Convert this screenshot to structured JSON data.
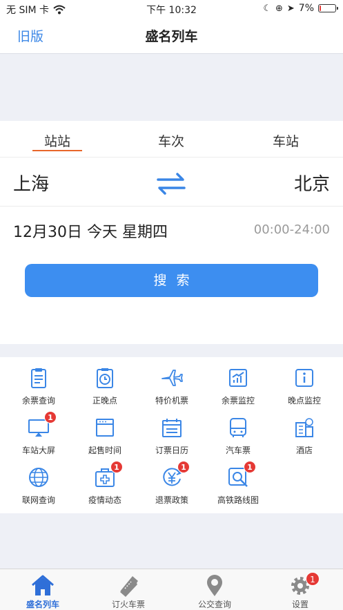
{
  "status_bar": {
    "carrier": "无 SIM 卡",
    "time": "下午 10:32",
    "battery": "7%",
    "battery_level": 0.07
  },
  "nav": {
    "back_label": "旧版",
    "title": "盛名列车"
  },
  "search": {
    "tabs": [
      {
        "label": "站站",
        "active": true
      },
      {
        "label": "车次",
        "active": false
      },
      {
        "label": "车站",
        "active": false
      }
    ],
    "from_station": "上海",
    "to_station": "北京",
    "date_text": "12月30日 今天 星期四",
    "time_range": "00:00-24:00",
    "search_button": "搜索"
  },
  "grid": [
    {
      "label": "余票查询",
      "icon": "clipboard-icon",
      "badge": null
    },
    {
      "label": "正晚点",
      "icon": "clock-icon",
      "badge": null
    },
    {
      "label": "特价机票",
      "icon": "airplane-icon",
      "badge": null
    },
    {
      "label": "余票监控",
      "icon": "chart-icon",
      "badge": null
    },
    {
      "label": "晚点监控",
      "icon": "info-icon",
      "badge": null
    },
    {
      "label": "车站大屏",
      "icon": "screen-icon",
      "badge": "1"
    },
    {
      "label": "起售时间",
      "icon": "window-icon",
      "badge": null
    },
    {
      "label": "订票日历",
      "icon": "calendar-icon",
      "badge": null
    },
    {
      "label": "汽车票",
      "icon": "bus-icon",
      "badge": null
    },
    {
      "label": "酒店",
      "icon": "hotel-icon",
      "badge": null
    },
    {
      "label": "联网查询",
      "icon": "globe-icon",
      "badge": null
    },
    {
      "label": "疫情动态",
      "icon": "medical-kit-icon",
      "badge": "1"
    },
    {
      "label": "退票政策",
      "icon": "yen-refund-icon",
      "badge": "1"
    },
    {
      "label": "高铁路线图",
      "icon": "map-search-icon",
      "badge": "1"
    }
  ],
  "tab_bar": [
    {
      "label": "盛名列车",
      "icon": "home-icon",
      "active": true,
      "badge": null
    },
    {
      "label": "订火车票",
      "icon": "ticket-icon",
      "active": false,
      "badge": null
    },
    {
      "label": "公交查询",
      "icon": "location-pin-icon",
      "active": false,
      "badge": null
    },
    {
      "label": "设置",
      "icon": "gear-icon",
      "active": false,
      "badge": "1"
    }
  ],
  "colors": {
    "accent": "#3d8ef0",
    "tab_underline": "#e8662a",
    "badge": "#e53935",
    "icon": "#3a86e6"
  }
}
